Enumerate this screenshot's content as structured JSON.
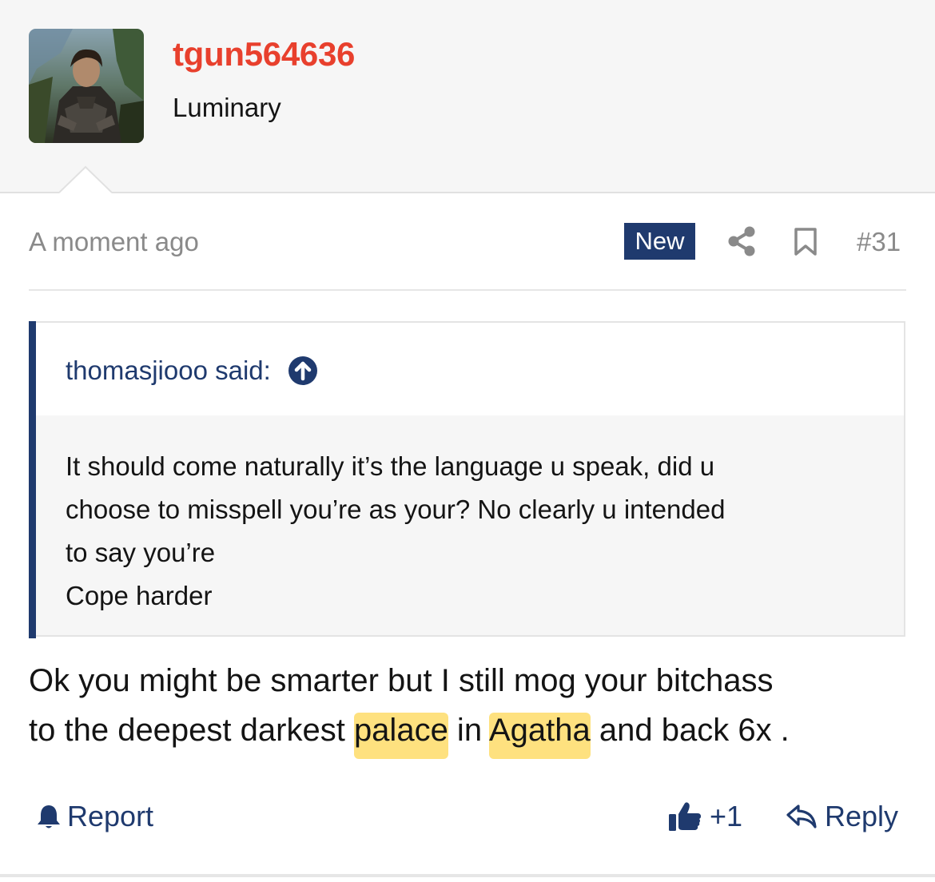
{
  "post_author": {
    "username": "tgun564636",
    "user_title": "Luminary",
    "avatar_icon": "avatar-image"
  },
  "post_meta": {
    "time": "A moment ago",
    "new_badge": "New",
    "share_icon": "share-icon",
    "bookmark_icon": "bookmark-icon",
    "post_number": "#31"
  },
  "quote": {
    "attribution": "thomasjiooo said:",
    "expand_icon": "arrow-up-circle-icon",
    "lines": [
      "It should come naturally it’s the language u speak, did u",
      "choose to misspell you’re as your? No clearly u intended",
      "to say you’re",
      "Cope harder"
    ]
  },
  "message": {
    "line1": "Ok you might be smarter but I still mog your bitchass",
    "line2_a": "to the deepest darkest ",
    "line2_hl1": "palace",
    "line2_b": " in ",
    "line2_hl2": "Agatha",
    "line2_c": " and back 6x ."
  },
  "actions": {
    "report": "Report",
    "like_count": "+1",
    "reply": "Reply"
  },
  "colors": {
    "username": "#e8402d",
    "accent": "#1f3a6e",
    "muted": "#8a8a8a",
    "highlight": "#fdd64d"
  }
}
